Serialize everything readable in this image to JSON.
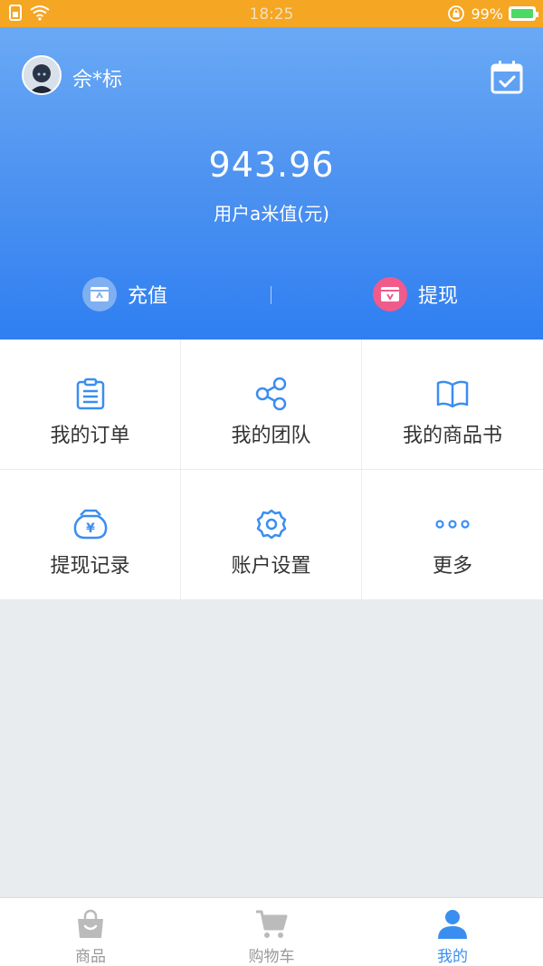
{
  "status_bar": {
    "time": "18:25",
    "battery_percent": "99%",
    "battery_level": 0.99,
    "icons": [
      "sim-icon",
      "wifi-icon",
      "lock-rotation-icon",
      "battery-icon"
    ]
  },
  "header": {
    "username": "佘*标",
    "balance": "943.96",
    "balance_label": "用户a米值(元)",
    "actions": [
      {
        "label": "充值",
        "icon": "recharge-icon",
        "color": "#7fb0f2"
      },
      {
        "label": "提现",
        "icon": "withdraw-icon",
        "color": "#f05b8c"
      }
    ]
  },
  "grid": {
    "items": [
      {
        "label": "我的订单",
        "icon": "clipboard-icon"
      },
      {
        "label": "我的团队",
        "icon": "share-nodes-icon"
      },
      {
        "label": "我的商品书",
        "icon": "book-icon"
      },
      {
        "label": "提现记录",
        "icon": "money-bag-icon"
      },
      {
        "label": "账户设置",
        "icon": "gear-icon"
      },
      {
        "label": "更多",
        "icon": "more-dots-icon"
      }
    ]
  },
  "bottom_nav": {
    "items": [
      {
        "label": "商品",
        "icon": "shopping-bag-icon",
        "active": false
      },
      {
        "label": "购物车",
        "icon": "cart-icon",
        "active": false
      },
      {
        "label": "我的",
        "icon": "user-icon",
        "active": true
      }
    ]
  },
  "colors": {
    "status_bar": "#f5a623",
    "header_top": "#6aa9f5",
    "header_bottom": "#2f7ff2",
    "accent": "#3a8ef0",
    "withdraw_pink": "#f05b8c",
    "inactive_gray": "#bbbbbb",
    "background": "#e9ecee"
  }
}
